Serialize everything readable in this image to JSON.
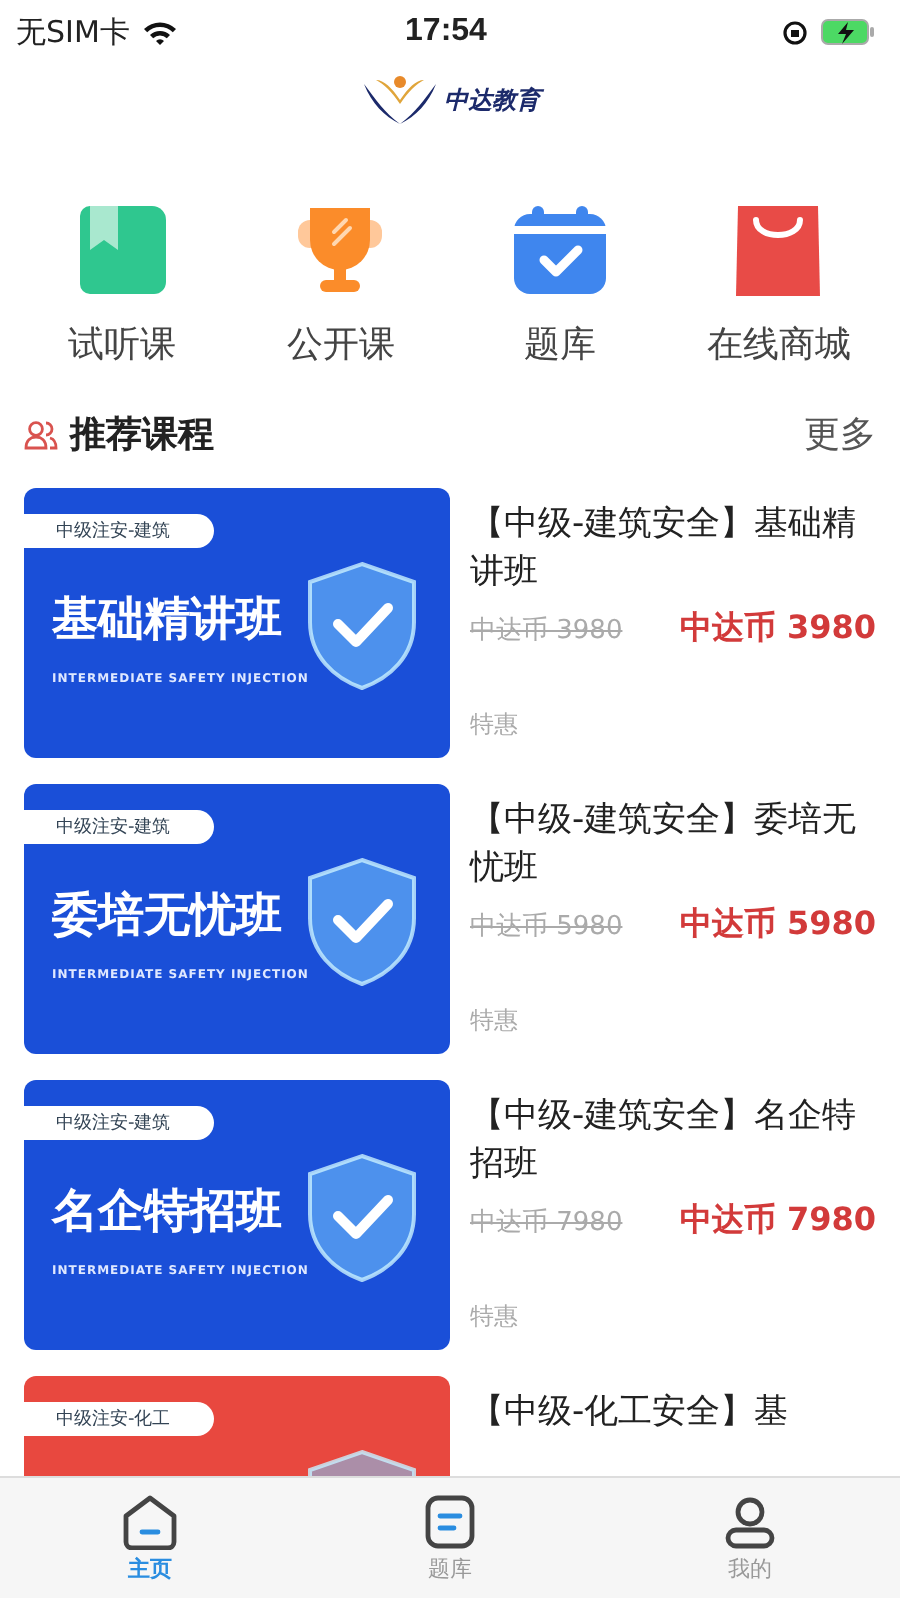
{
  "status_bar": {
    "carrier": "无SIM卡",
    "time": "17:54"
  },
  "header": {
    "logo_text": "中达教育"
  },
  "shortcuts": [
    {
      "kind": "bookmark",
      "label": "试听课"
    },
    {
      "kind": "trophy",
      "label": "公开课"
    },
    {
      "kind": "calendar",
      "label": "题库"
    },
    {
      "kind": "bag",
      "label": "在线商城"
    }
  ],
  "section": {
    "title": "推荐课程",
    "more": "更多"
  },
  "courses": [
    {
      "banner": {
        "color": "#1a4fd8",
        "tag": "中级注安-建筑",
        "headline": "基础精讲班",
        "subtitle": "INTERMEDIATE SAFETY INJECTION"
      },
      "title": "【中级-建筑安全】基础精讲班",
      "old_price": "中达币 3980",
      "price": "中达币 3980",
      "badge": "特惠"
    },
    {
      "banner": {
        "color": "#1a4fd8",
        "tag": "中级注安-建筑",
        "headline": "委培无忧班",
        "subtitle": "INTERMEDIATE SAFETY INJECTION"
      },
      "title": "【中级-建筑安全】委培无忧班",
      "old_price": "中达币 5980",
      "price": "中达币 5980",
      "badge": "特惠"
    },
    {
      "banner": {
        "color": "#1a4fd8",
        "tag": "中级注安-建筑",
        "headline": "名企特招班",
        "subtitle": "INTERMEDIATE SAFETY INJECTION"
      },
      "title": "【中级-建筑安全】名企特招班",
      "old_price": "中达币 7980",
      "price": "中达币 7980",
      "badge": "特惠"
    },
    {
      "banner": {
        "color": "#e8483f",
        "tag": "中级注安-化工"
      },
      "title": "【中级-化工安全】基"
    }
  ],
  "tab_bar": [
    {
      "kind": "home",
      "label": "主页",
      "selected": true
    },
    {
      "kind": "list",
      "label": "题库",
      "selected": false
    },
    {
      "kind": "user",
      "label": "我的",
      "selected": false
    }
  ]
}
